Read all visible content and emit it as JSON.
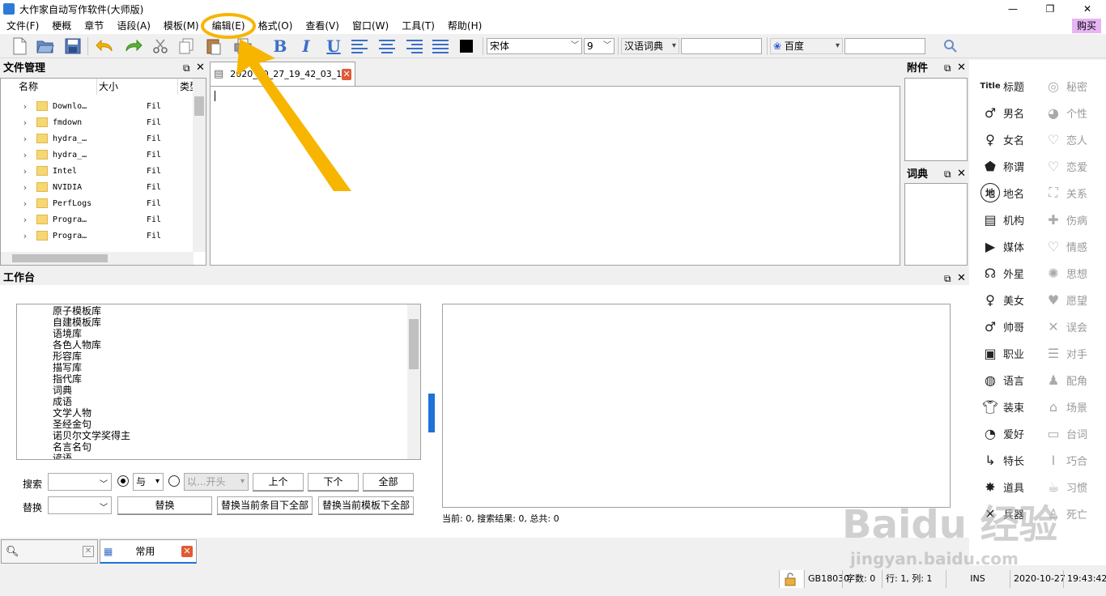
{
  "window": {
    "title": "大作家自动写作软件(大师版)",
    "controls": [
      "—",
      "❐",
      "✕"
    ]
  },
  "menu": {
    "items": [
      "文件(F)",
      "梗概",
      "章节",
      "语段(A)",
      "模板(M)",
      "编辑(E)",
      "格式(O)",
      "查看(V)",
      "窗口(W)",
      "工具(T)",
      "帮助(H)"
    ],
    "buy": "购买"
  },
  "toolbar": {
    "bold": "B",
    "italic": "I",
    "underline": "U",
    "font": "宋体",
    "size": "9",
    "dict": "汉语词典",
    "search_engine": "百度"
  },
  "file_panel": {
    "title": "文件管理",
    "columns": [
      "名称",
      "大小",
      "类型"
    ],
    "rows": [
      {
        "name": "Downlo…",
        "type": "Fil"
      },
      {
        "name": "fmdown",
        "type": "Fil"
      },
      {
        "name": "hydra_…",
        "type": "Fil"
      },
      {
        "name": "hydra_…",
        "type": "Fil"
      },
      {
        "name": "Intel",
        "type": "Fil"
      },
      {
        "name": "NVIDIA",
        "type": "Fil"
      },
      {
        "name": "PerfLogs",
        "type": "Fil"
      },
      {
        "name": "Progra…",
        "type": "Fil"
      },
      {
        "name": "Progra…",
        "type": "Fil"
      }
    ]
  },
  "editor": {
    "tab_label": "2020_10_27_19_42_03_1"
  },
  "attach_panel": {
    "title": "附件"
  },
  "dict_panel": {
    "title": "词典"
  },
  "workbench": {
    "title": "工作台",
    "libraries": [
      "原子模板库",
      "自建模板库",
      "语境库",
      "各色人物库",
      "形容库",
      "描写库",
      "指代库",
      "词典",
      "成语",
      "文学人物",
      "圣经金句",
      "诺贝尔文学奖得主",
      "名言名句",
      "谚语"
    ],
    "search_label": "搜索",
    "replace_label": "替换",
    "and_option": "与",
    "starts_with": "以...开头",
    "prev": "上个",
    "next": "下个",
    "all": "全部",
    "replace_btn": "替换",
    "replace_entry": "替换当前条目下全部",
    "replace_template": "替换当前模板下全部",
    "result_text": "当前: 0, 搜索结果: 0, 总共: 0"
  },
  "bottom_tabs": {
    "common": "常用"
  },
  "sidebar": {
    "left": [
      "标题",
      "男名",
      "女名",
      "称谓",
      "地名",
      "机构",
      "媒体",
      "外星",
      "美女",
      "帅哥",
      "职业",
      "语言",
      "装束",
      "爱好",
      "特长",
      "道具",
      "兵器"
    ],
    "right": [
      "秘密",
      "个性",
      "恋人",
      "恋爱",
      "关系",
      "伤病",
      "情感",
      "思想",
      "愿望",
      "误会",
      "对手",
      "配角",
      "场景",
      "台词",
      "巧合",
      "习惯",
      "死亡"
    ],
    "title_icon_text": "Title",
    "place_icon_text": "地"
  },
  "status": {
    "encoding": "GB18030",
    "chars": "字数: 0",
    "position": "行: 1, 列: 1",
    "mode": "INS",
    "date": "2020-10-27",
    "time": "19:43:42"
  },
  "watermark": {
    "brand": "Baidu 经验",
    "url": "jingyan.baidu.com"
  },
  "colors": {
    "annotation": "#f7b500",
    "accent_blue": "#3b6fc7",
    "buy_bg": "#e7b5f3",
    "tab_close": "#e15a36"
  }
}
